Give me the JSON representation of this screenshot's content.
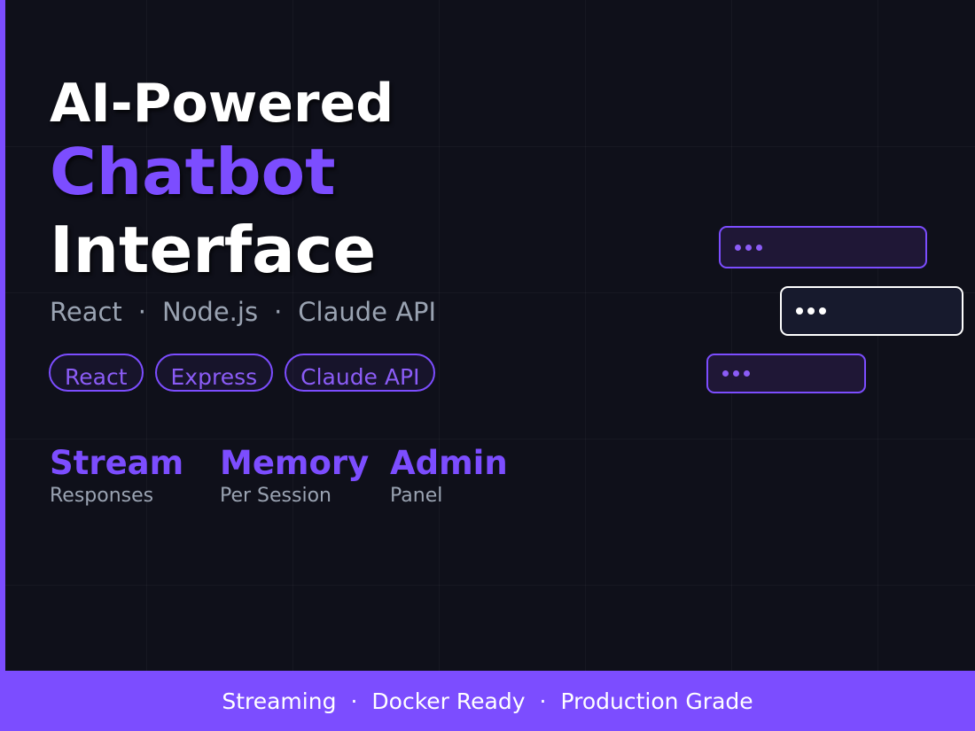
{
  "colors": {
    "background": "#0f101a",
    "accent": "#7c4dff",
    "text_primary": "#ffffff",
    "text_muted": "#9aa3b2"
  },
  "title": {
    "line1": "AI-Powered",
    "line2": "Chatbot",
    "line3": "Interface"
  },
  "subtitle": {
    "items": [
      "React",
      "Node.js",
      "Claude API"
    ],
    "separator": "·"
  },
  "tags": [
    "React",
    "Express",
    "Claude API"
  ],
  "stats": [
    {
      "value": "Stream",
      "label": "Responses"
    },
    {
      "value": "Memory",
      "label": "Per Session"
    },
    {
      "value": "Admin",
      "label": "Panel"
    }
  ],
  "chat_bubbles": [
    {
      "role": "assistant",
      "icon": "typing-dots"
    },
    {
      "role": "user",
      "icon": "typing-dots"
    },
    {
      "role": "assistant",
      "icon": "typing-dots"
    }
  ],
  "footer": {
    "items": [
      "Streaming",
      "Docker Ready",
      "Production Grade"
    ],
    "separator": "·"
  }
}
